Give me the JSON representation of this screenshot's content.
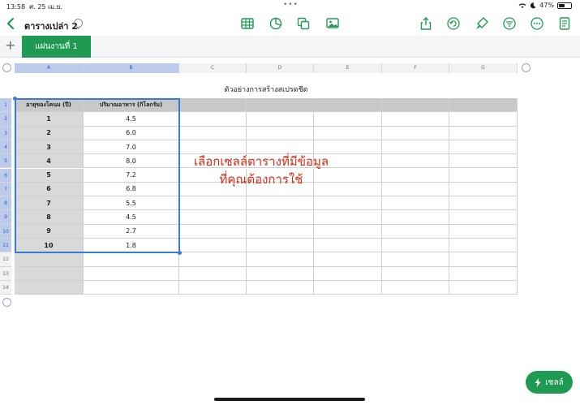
{
  "status": {
    "time": "13:58",
    "date": "ศ. 25 เม.ย.",
    "battery": "47%",
    "battery_level": 0.47
  },
  "toolbar": {
    "doc_title": "ตารางเปล่า 2",
    "center_icons": [
      "table-icon",
      "chart-icon",
      "shape-icon",
      "media-icon"
    ],
    "right_icons": [
      "share-icon",
      "undo-icon",
      "format-brush-icon",
      "filter-icon",
      "more-icon",
      "document-icon"
    ]
  },
  "tabs": {
    "add": "+",
    "sheet": "แผ่นงานที่ 1"
  },
  "columns": [
    "A",
    "B",
    "C",
    "D",
    "E",
    "F",
    "G"
  ],
  "rows": [
    "1",
    "2",
    "3",
    "4",
    "5",
    "6",
    "7",
    "8",
    "9",
    "10",
    "11",
    "12",
    "13",
    "14"
  ],
  "table": {
    "title": "ตัวอย่างการสร้างสเปรดชีต",
    "headers": [
      "อายุของโคนม (ปี)",
      "ปริมาณอาหาร (กิโลกรัม)"
    ],
    "data": [
      [
        "1",
        "4.5"
      ],
      [
        "2",
        "6.0"
      ],
      [
        "3",
        "7.0"
      ],
      [
        "4",
        "8.0"
      ],
      [
        "5",
        "7.2"
      ],
      [
        "6",
        "6.8"
      ],
      [
        "7",
        "5.5"
      ],
      [
        "8",
        "4.5"
      ],
      [
        "9",
        "2.7"
      ],
      [
        "10",
        "1.8"
      ]
    ]
  },
  "annotation": {
    "line1": "เลือกเซลล์ตารางที่มีข้อมูล",
    "line2": "ที่คุณต้องการใช้"
  },
  "cell_button": {
    "label": "เซลล์"
  },
  "colors": {
    "accent_green": "#1f9a52",
    "selection_blue": "#3b79d6",
    "annotation_red": "#d62a16"
  }
}
